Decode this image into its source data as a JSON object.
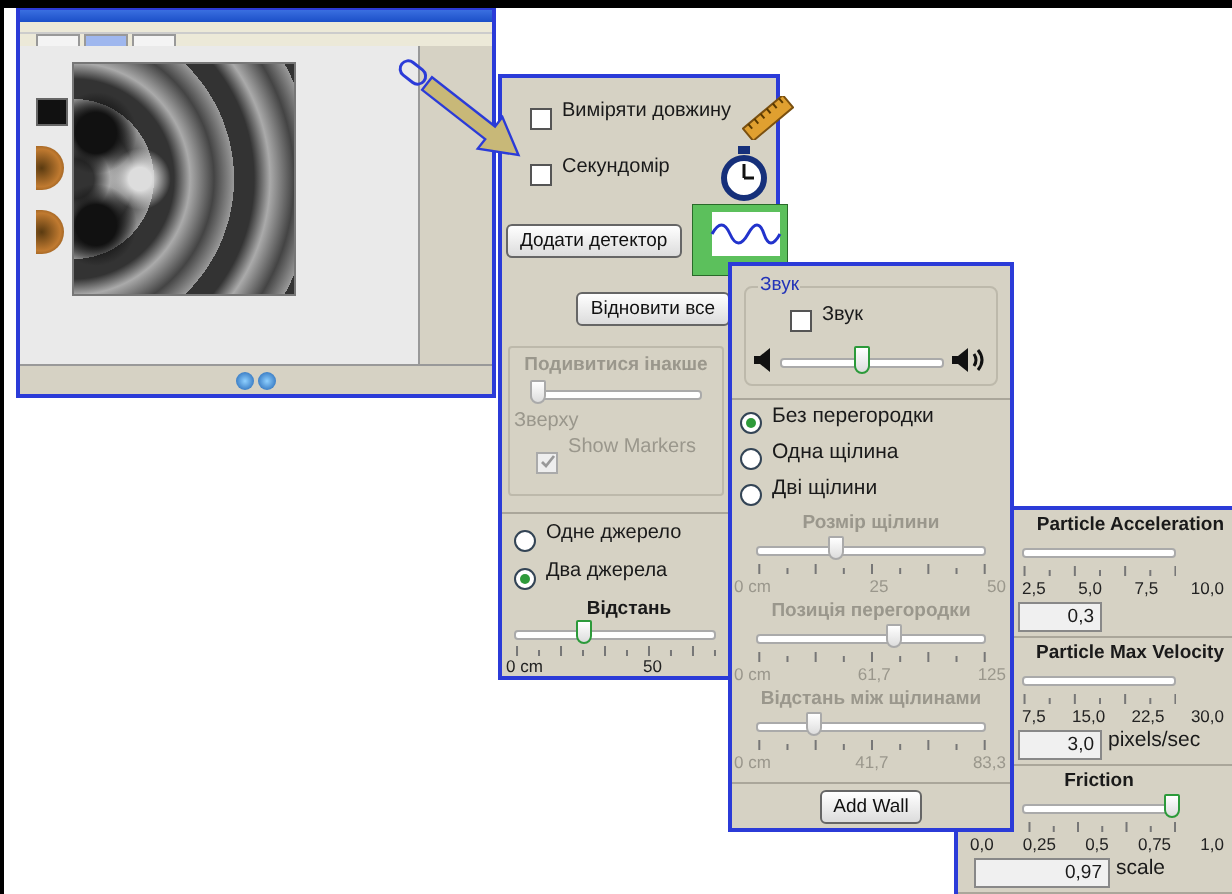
{
  "thumbnail": {
    "tabs": [
      {
        "selected": false
      },
      {
        "selected": true
      },
      {
        "selected": false
      }
    ]
  },
  "panel_view": {
    "tools": [
      {
        "kind": "checkbox",
        "label": "Виміряти довжину",
        "checked": false
      },
      {
        "kind": "checkbox",
        "label": "Секундомір",
        "checked": false
      },
      {
        "kind": "button",
        "label": "Додати детектор"
      }
    ],
    "reset_button": "Відновити все",
    "view_group": {
      "title": "Подивитися інакше",
      "disabled": true,
      "level": 0.05,
      "caption": "Зверху"
    },
    "show_markers": {
      "label": "Show Markers",
      "checked": true,
      "disabled": true
    },
    "sources": [
      {
        "label": "Одне джерело",
        "selected": false
      },
      {
        "label": "Два джерела",
        "selected": true
      }
    ],
    "distance": {
      "title": "Відстань",
      "level": 0.35,
      "tick_labels": [
        "0 cm",
        "50"
      ]
    }
  },
  "panel_barriers": {
    "sound": {
      "title": "Звук",
      "checkbox": {
        "label": "Звук",
        "checked": false
      },
      "level": 0.5
    },
    "barriers": [
      {
        "label": "Без перегородки",
        "selected": true
      },
      {
        "label": "Одна щілина",
        "selected": false
      },
      {
        "label": "Дві щілини",
        "selected": false
      }
    ],
    "sliders": [
      {
        "title": "Розмір щілини",
        "disabled": true,
        "level": 0.35,
        "tick_labels": [
          "0 cm",
          "25",
          "50"
        ]
      },
      {
        "title": "Позиція перегородки",
        "disabled": true,
        "level": 0.6,
        "tick_labels": [
          "0 cm",
          "61,7",
          "125"
        ]
      },
      {
        "title": "Відстань між щілинами",
        "disabled": true,
        "level": 0.25,
        "tick_labels": [
          "0 cm",
          "41,7",
          "83,3"
        ]
      }
    ],
    "add_wall_button": "Add Wall"
  },
  "panel_particles": {
    "controls": [
      {
        "title": "Particle Acceleration",
        "tick_labels": [
          "2,5",
          "5,0",
          "7,5",
          "10,0"
        ],
        "value": "0,3"
      },
      {
        "title": "Particle Max Velocity",
        "tick_labels": [
          "7,5",
          "15,0",
          "22,5",
          "30,0"
        ],
        "value": "3,0",
        "unit": "pixels/sec"
      },
      {
        "title": "Friction",
        "tick_labels": [
          "0,0",
          "0,25",
          "0,5",
          "0,75",
          "1,0"
        ],
        "level": 0.97,
        "value": "0,97",
        "unit": "scale"
      }
    ]
  }
}
